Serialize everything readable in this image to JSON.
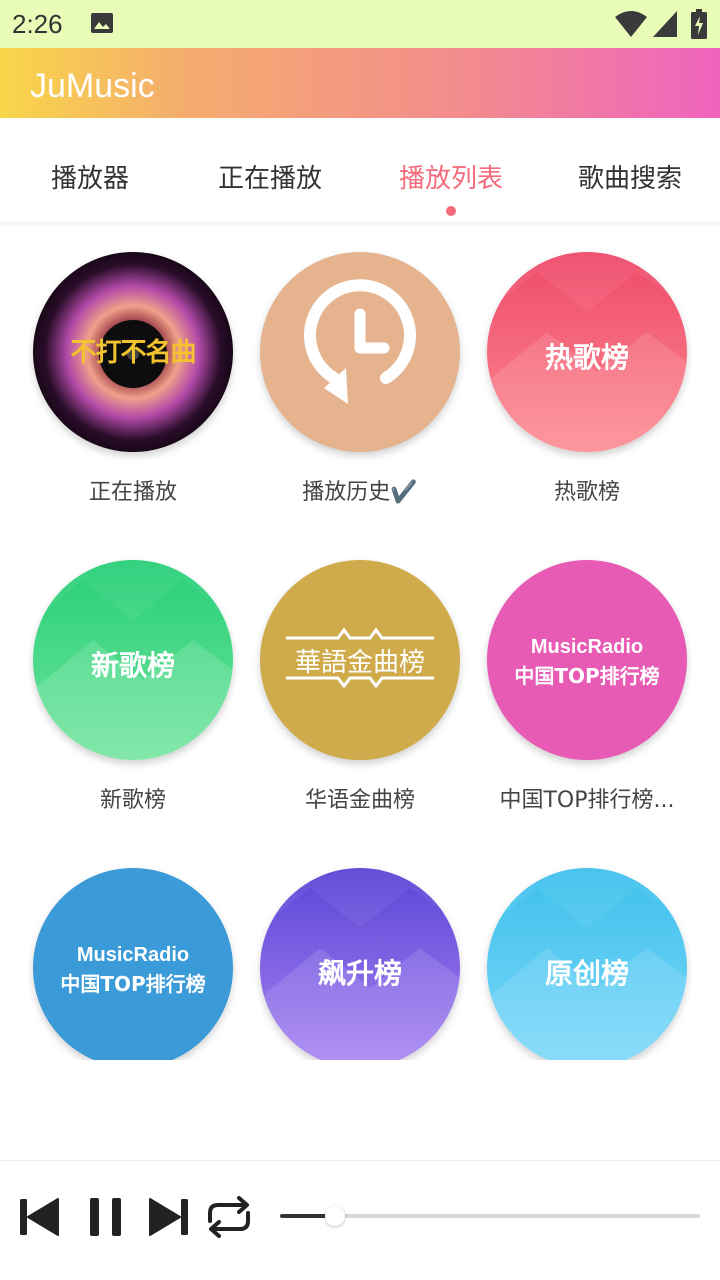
{
  "status_bar": {
    "time": "2:26",
    "icons": [
      "image-icon",
      "wifi-icon",
      "signal-icon",
      "battery-icon"
    ]
  },
  "app_bar": {
    "title": "JuMusic"
  },
  "tabs": [
    {
      "label": "播放器",
      "active": false
    },
    {
      "label": "正在播放",
      "active": false
    },
    {
      "label": "播放列表",
      "active": true
    },
    {
      "label": "歌曲搜索",
      "active": false
    }
  ],
  "playlists": [
    {
      "label": "正在播放",
      "cover_text": "不打不名曲"
    },
    {
      "label": "播放历史✔️",
      "cover_icon": "history-clock-icon"
    },
    {
      "label": "热歌榜",
      "cover_text": "热歌榜"
    },
    {
      "label": "新歌榜",
      "cover_text": "新歌榜"
    },
    {
      "label": "华语金曲榜",
      "cover_text": "華語金曲榜"
    },
    {
      "label": "中国TOP排行榜...",
      "cover_text_top": "MusicRadio",
      "cover_text_bottom": "中国TOP排行榜"
    },
    {
      "label": "",
      "cover_text_top": "MusicRadio",
      "cover_text_bottom": "中国TOP排行榜"
    },
    {
      "label": "",
      "cover_text": "飙升榜"
    },
    {
      "label": "",
      "cover_text": "原创榜"
    }
  ],
  "player": {
    "controls": [
      "previous-icon",
      "pause-icon",
      "next-icon",
      "repeat-icon"
    ],
    "progress": 0.13
  },
  "colors": {
    "accent": "#f56b7b",
    "status_bar_bg": "#e8fcb8",
    "app_bar_gradient": [
      "#f8d648",
      "#f4ad6d",
      "#f38b8e",
      "#ef63bf"
    ]
  }
}
